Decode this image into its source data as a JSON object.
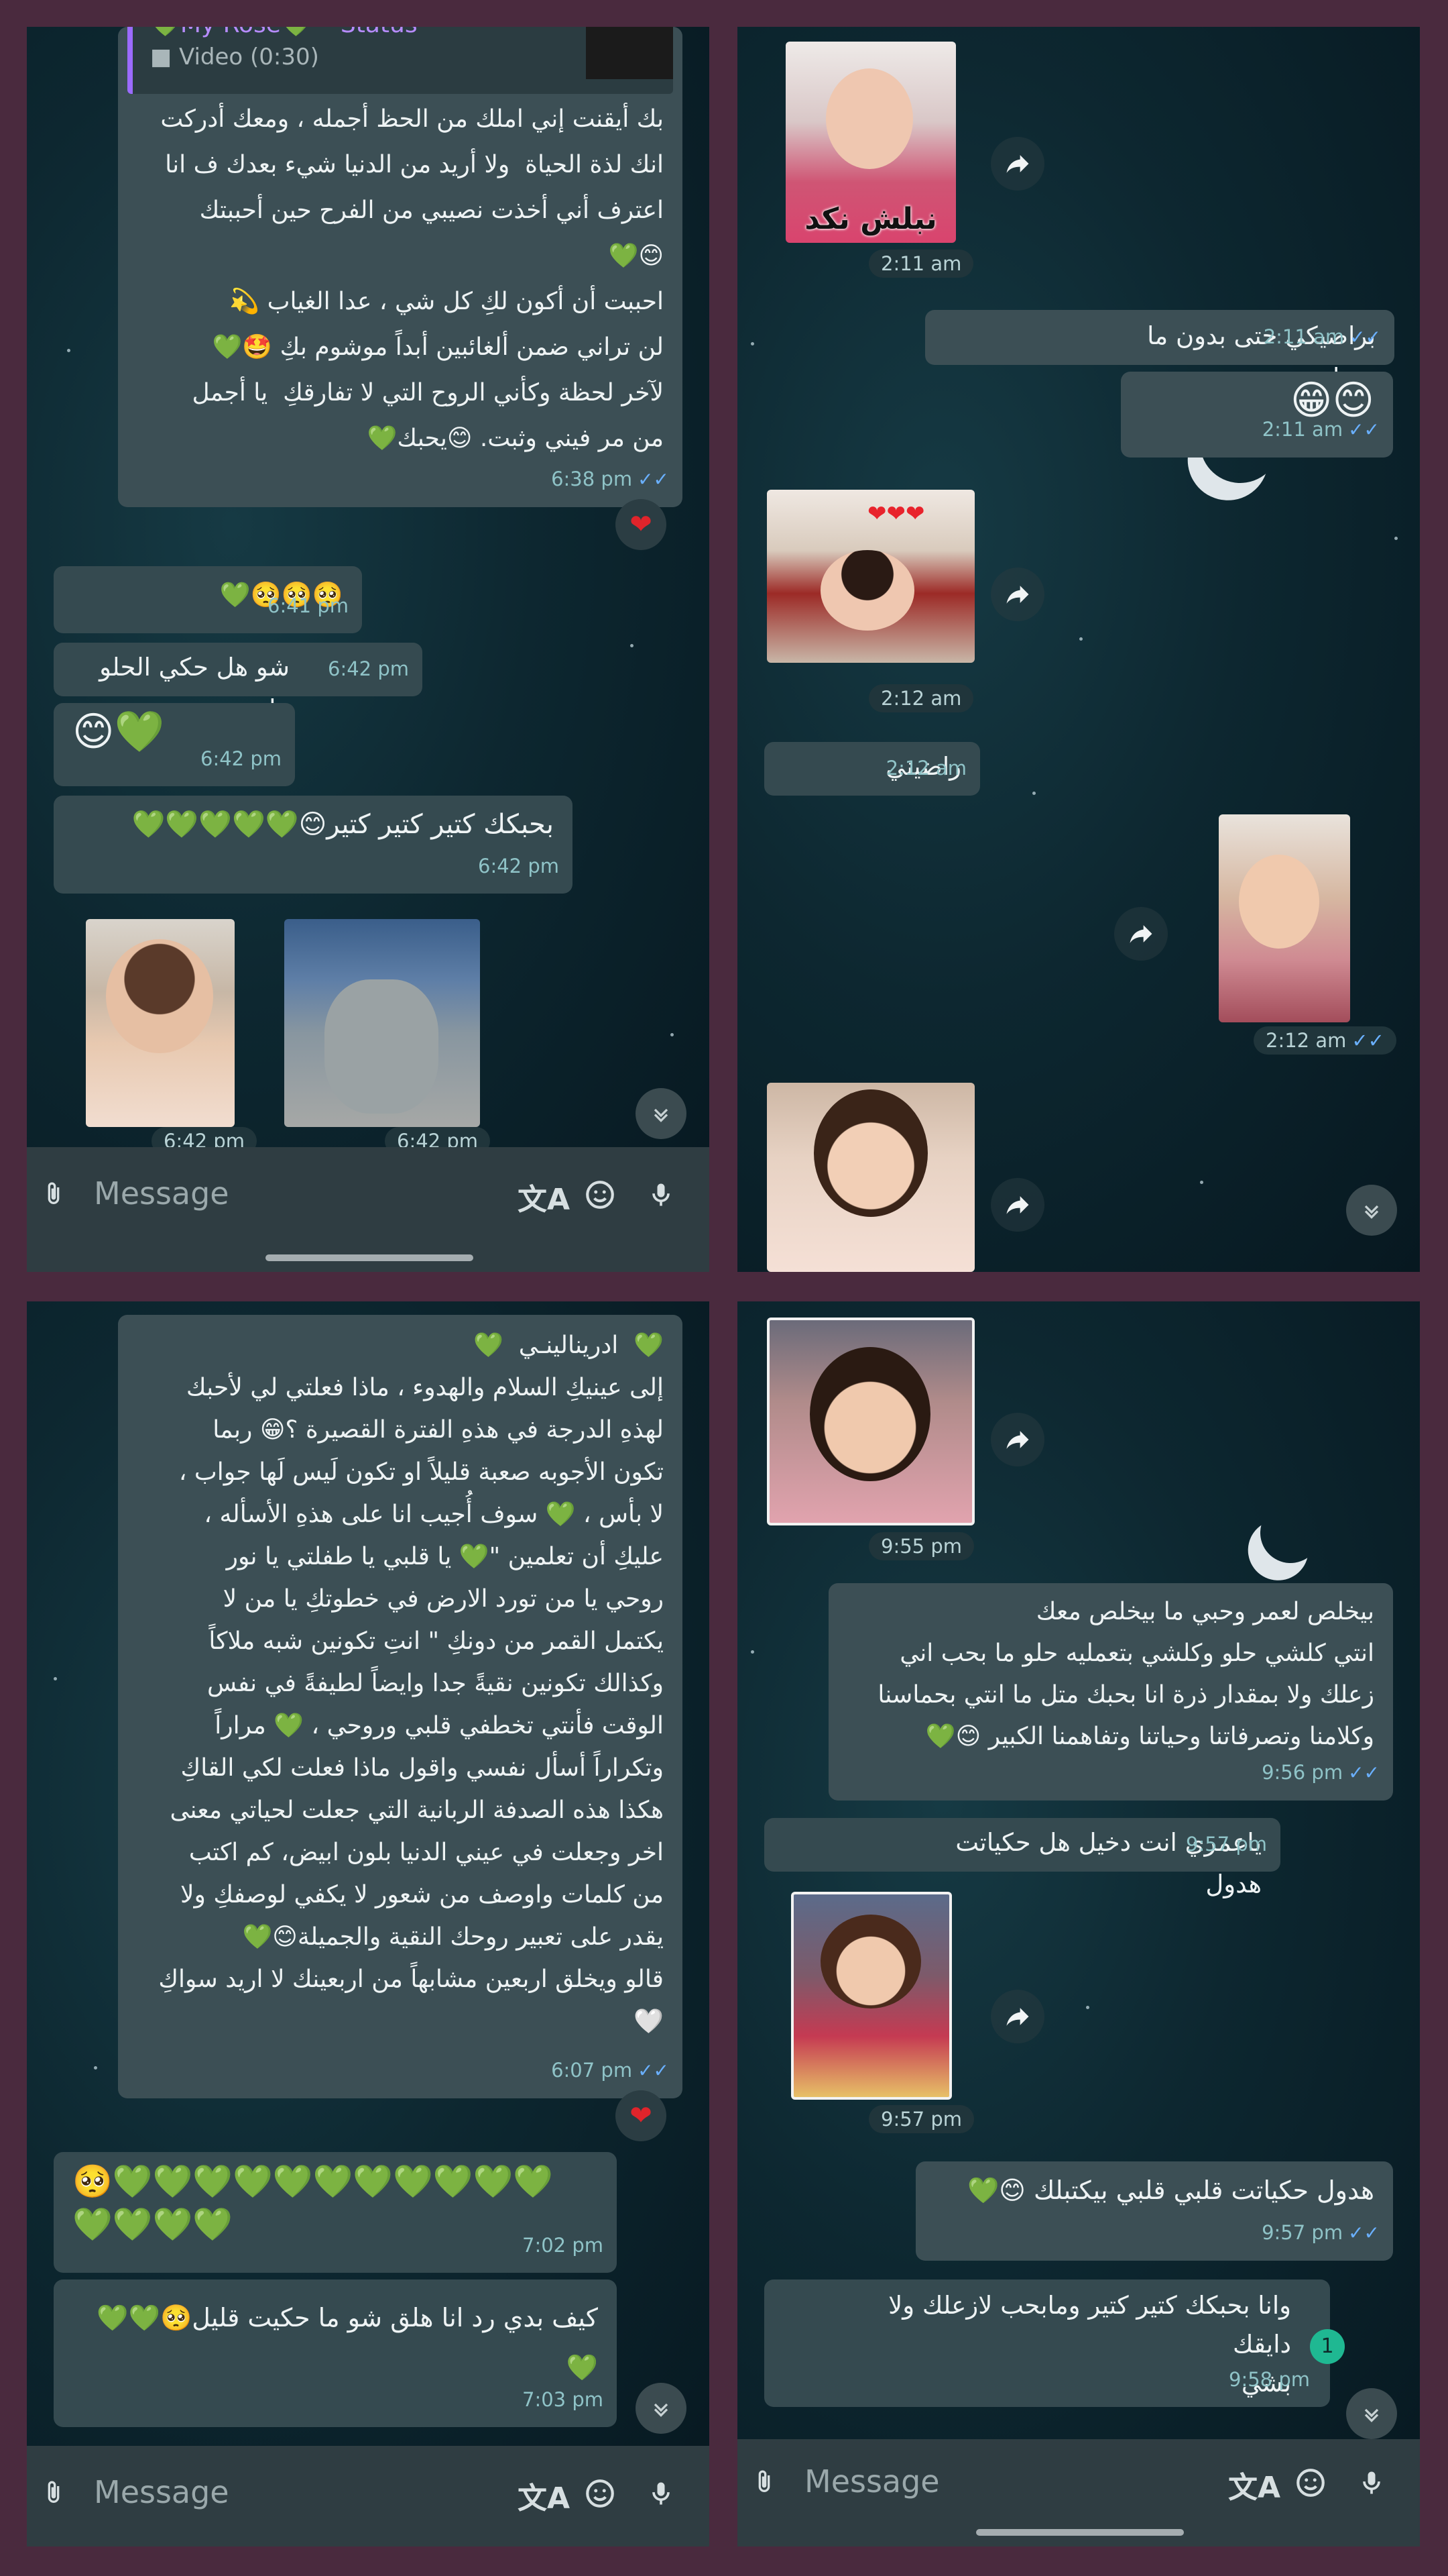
{
  "panels": {
    "tl": {
      "reply": {
        "name": "💚My Rose💚 • Status",
        "sub": "Video (0:30)"
      },
      "msg1": {
        "text": "بك أيقنت إني املك من الحظ أجمله ، ومعك أدركت\nانك لذة الحياة  ولا أريد من الدنيا شيء بعدك ف انا\nاعترف أني أخذت نصيبي من الفرح حين أحببتك\n😊💚\nاحببت أن أكون لكِ كل شي ، عدا الغياب 💫\nلن تراني ضمن ألغائبين أبداً موشوم بكِ 🤩💚\nلآخر لحظة وكأني الروح التي لا تفارقكِ  يا أجمل\nمن مر فيني وثبت. 😊يحبك💚",
        "time": "6:38 pm",
        "reaction": "❤"
      },
      "msg2": {
        "text": "🥺🥺🥺💚",
        "time": "6:41 pm"
      },
      "msg3": {
        "text": "شو هل حكي الحلو هاد",
        "time": "6:42 pm"
      },
      "msg4": {
        "text": "😊💚",
        "time": "6:42 pm"
      },
      "msg5": {
        "text": "بحبكك كتير كتير كتير😊💚💚💚💚💚",
        "time": "6:42 pm"
      },
      "photo_times": [
        "6:42 pm",
        "6:42 pm"
      ],
      "input_placeholder": "Message"
    },
    "tr": {
      "photo1": {
        "caption": "نبلش نكد",
        "time": "2:11 am"
      },
      "msg1": {
        "text": "براضيكي حتى بدون ما تزعلي",
        "time": "2:11 am"
      },
      "msg2": {
        "text": "😊😁",
        "time": "2:11 am"
      },
      "photo2": {
        "time": "2:12 am"
      },
      "msg3": {
        "text": "راضيني",
        "time": "2:12 am"
      },
      "photo3": {
        "time": "2:12 am"
      }
    },
    "bl": {
      "msg1": {
        "text": "💚  ادرينالينـي  💚\nإلى عينيكِ السلام والهدوء ، ماذا فعلتي لي لأحبك\nلهذهِ الدرجة في هذهِ الفترة القصيرة ؟😁 ربما\nتكون الأجوبه صعبة قليلاً او تكون لَيس لَها جواب ،\nلا بأس ، 💚 سوف أُجيب انا على هذهِ الأسأله ،\nعليكِ أن تعلمين \"💚 يا قلبي يا طفلتي يا نور\nروحي يا من تورد الارض في خطوتكِ يا من لا\nيكتمل القمر من دونكِ \" انتِ تكونين شبه ملاكاً\nوكذالك تكونين نقيةً جدا وايضاً لطيفةً في نفس\nالوقت فأنتي تخطفي قلبي وروحي ، 💚 مراراً\nوتكراراً أسأل نفسي واقول ماذا فعلت لكي القاكِ\nهكذا هذه الصدفة الربانية التي جعلت لحياتي معنى\nاخر وجعلت في عيني الدنيا بلون ابيض، كم اكتب\nمن كلمات واوصف من شعور لا يكفي لوصفكِ ولا\nيقدر على تعبير روحك النقية والجميلة😊💚\nقالو ويخلق اربعين مشابهاً من اربعينك لا اريد سواكِ\n🤍",
        "time": "6:07 pm",
        "reaction": "❤"
      },
      "msg2": {
        "text": "🥺💚💚💚💚💚💚💚💚💚💚💚\n💚💚💚💚",
        "time": "7:02 pm"
      },
      "msg3": {
        "text": "كيف بدي رد انا هلق شو ما حكيت قليل🥺💚💚\n💚",
        "time": "7:03 pm"
      },
      "input_placeholder": "Message"
    },
    "br": {
      "photo1": {
        "time": "9:55 pm"
      },
      "msg1": {
        "text": "بيخلص لعمر وحبي ما بيخلص معك\nانتي كلشي حلو وكلشي بتعمليه حلو ما بحب اني\nزعلك ولا بمقدار ذرة انا بحبك متل ما انتي بحماسنا\nوكلامنا وتصرفاتنا وحياتنا وتفاهمنا الكبير 😊💚",
        "time": "9:56 pm"
      },
      "msg2": {
        "text": "ياعمري انت دخيل هل حكياتت هدول",
        "time": "9:57 pm"
      },
      "photo2": {
        "time": "9:57 pm"
      },
      "msg3": {
        "text": "هدول حكياتت قلبي قلبي بيكتبلك 😊💚",
        "time": "9:57 pm"
      },
      "msg4": {
        "text": "وانا بحبكك كتير كتير ومابحب لازعلك ولا دايقك\nبشي",
        "time": "9:58 pm"
      },
      "unread_badge": "1",
      "input_placeholder": "Message"
    }
  },
  "colors": {
    "incoming": "#354a50",
    "outgoing": "#3c4f55",
    "tick": "#6ab0ff",
    "time": "#8fc3c7"
  },
  "icons": [
    "attach-icon",
    "translate-icon",
    "emoji-icon",
    "mic-icon",
    "forward-icon",
    "chevron-down-icon",
    "heart-reaction-icon",
    "double-check-icon"
  ]
}
